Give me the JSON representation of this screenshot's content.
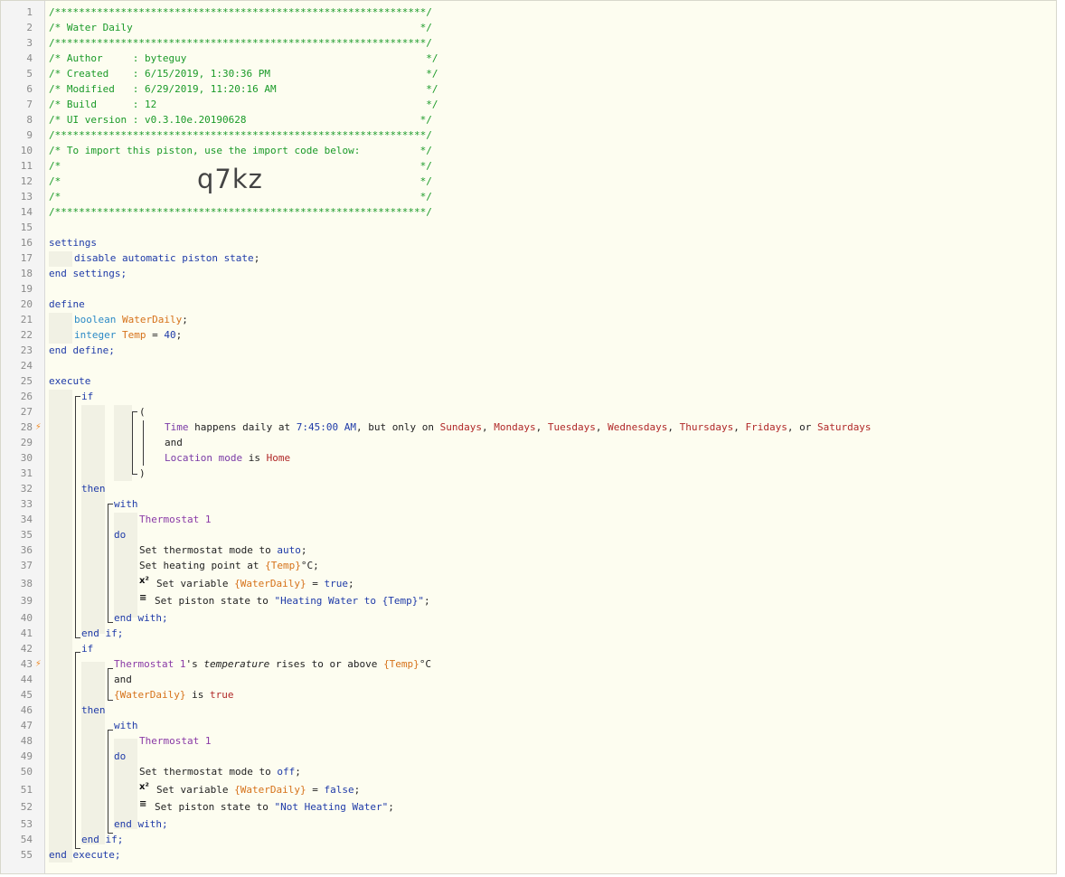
{
  "header": {
    "border": "/**************************************************************/",
    "title_line": "/* Water Daily                                                */",
    "author_line": "/* Author     : byteguy                                        */",
    "created_line": "/* Created    : 6/15/2019, 1:30:36 PM                          */",
    "modified_line": "/* Modified   : 6/29/2019, 11:20:16 AM                         */",
    "build_line": "/* Build      : 12                                             */",
    "ui_line": "/* UI version : v0.3.10e.20190628                             */",
    "import_line": "/* To import this piston, use the import code below:          */",
    "blank_line": "/*                                                            */",
    "import_code": "q7kz"
  },
  "line_numbers": [
    "1",
    "2",
    "3",
    "4",
    "5",
    "6",
    "7",
    "8",
    "9",
    "10",
    "11",
    "12",
    "13",
    "14",
    "15",
    "16",
    "17",
    "18",
    "19",
    "20",
    "21",
    "22",
    "23",
    "24",
    "25",
    "26",
    "27",
    "28",
    "29",
    "30",
    "31",
    "32",
    "33",
    "34",
    "35",
    "36",
    "37",
    "38",
    "39",
    "40",
    "41",
    "42",
    "43",
    "44",
    "45",
    "46",
    "47",
    "48",
    "49",
    "50",
    "51",
    "52",
    "53",
    "54",
    "55"
  ],
  "kw": {
    "settings": "settings",
    "end_settings": "end settings;",
    "disable": "disable automatic piston state",
    "semi": ";",
    "define": "define",
    "boolean": "boolean",
    "integer": "integer",
    "end_define": "end define;",
    "execute": "execute",
    "if": "if",
    "then": "then",
    "with": "with",
    "do": "do",
    "end_with": "end with;",
    "end_if": "end if;",
    "and": "and",
    "end_execute": "end execute;",
    "open_paren": "(",
    "close_paren": ")"
  },
  "vars": {
    "water_daily": "WaterDaily",
    "temp": "Temp",
    "temp_value": "40",
    "equals": " = ",
    "water_daily_ref": "{WaterDaily}",
    "temp_ref": "{Temp}"
  },
  "conditions": {
    "time": "Time",
    "happens": " happens daily at ",
    "at_time": "7:45:00 AM",
    "only_on": ", but only on ",
    "days": [
      "Sundays",
      "Mondays",
      "Tuesdays",
      "Wednesdays",
      "Thursdays",
      "Fridays",
      "Saturdays"
    ],
    "comma": ", ",
    "or": ", or ",
    "location_mode": "Location mode",
    "is": " is ",
    "home": "Home",
    "thermostat_1s": "Thermostat 1",
    "possessive": "'s ",
    "temperature": "temperature",
    "rises": " rises to or above ",
    "deg_c": "°C",
    "true_val": "true"
  },
  "actions": {
    "device": "Thermostat 1",
    "set_mode": "Set thermostat mode to ",
    "auto": "auto",
    "off": "off",
    "set_heating": "Set heating point at ",
    "set_variable": "Set variable ",
    "true_val": "true",
    "false_val": "false",
    "set_state": "Set piston state to ",
    "state_heating": "\"Heating Water to {Temp}\"",
    "state_not_heating": "\"Not Heating Water\"",
    "var_icon": "x²",
    "state_icon": "≡"
  },
  "colors": {
    "comment": "#1a9a28",
    "keyword": "#1f3ba8",
    "variable": "#d6721a",
    "value": "#b02828",
    "device": "#8a3aa6",
    "trigger": "#f08a24"
  }
}
